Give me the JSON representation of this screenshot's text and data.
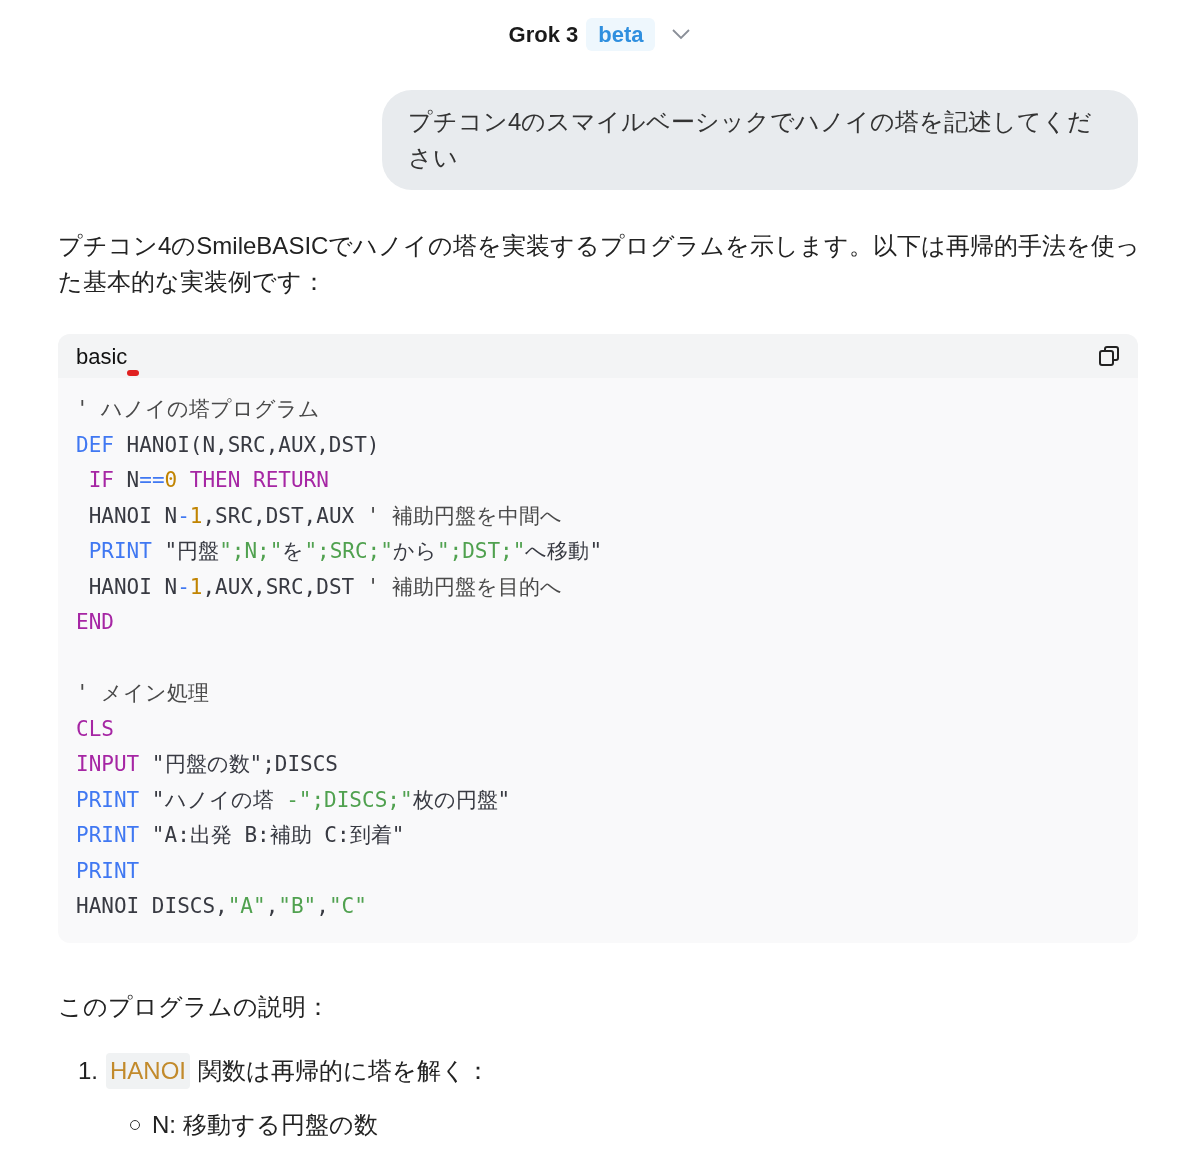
{
  "header": {
    "title": "Grok 3",
    "badge": "beta"
  },
  "user_message": "プチコン4のスマイルベーシックでハノイの塔を記述してください",
  "response_intro": "プチコン4のSmileBASICでハノイの塔を実装するプログラムを示します。以下は再帰的手法を使った基本的な実装例です：",
  "code_block": {
    "language": "basic",
    "lines": [
      {
        "kind": "code",
        "tokens": [
          {
            "kind": "comment",
            "s": "' ハノイの塔プログラム"
          }
        ]
      },
      {
        "kind": "code",
        "tokens": [
          {
            "kind": "blue",
            "s": "DEF"
          },
          {
            "kind": "plain",
            "s": " HANOI(N,SRC,AUX,DST)"
          }
        ]
      },
      {
        "kind": "code",
        "tokens": [
          {
            "kind": "purple",
            "s": " IF"
          },
          {
            "kind": "plain",
            "s": " N"
          },
          {
            "kind": "blue",
            "s": "=="
          },
          {
            "kind": "number",
            "s": "0"
          },
          {
            "kind": "purple",
            "s": " THEN RETURN"
          }
        ]
      },
      {
        "kind": "code",
        "tokens": [
          {
            "kind": "plain",
            "s": " HANOI N"
          },
          {
            "kind": "blue",
            "s": "-"
          },
          {
            "kind": "number",
            "s": "1"
          },
          {
            "kind": "plain",
            "s": ",SRC,DST,AUX"
          },
          {
            "kind": "comment",
            "s": " ' 補助円盤を中間へ"
          }
        ]
      },
      {
        "kind": "code",
        "tokens": [
          {
            "kind": "blue",
            "s": " PRINT"
          },
          {
            "kind": "plain",
            "s": " \"円盤"
          },
          {
            "kind": "string",
            "s": "\";N;\""
          },
          {
            "kind": "plain",
            "s": "を"
          },
          {
            "kind": "string",
            "s": "\";SRC;\""
          },
          {
            "kind": "plain",
            "s": "から"
          },
          {
            "kind": "string",
            "s": "\";DST;\""
          },
          {
            "kind": "plain",
            "s": "へ移動\""
          }
        ]
      },
      {
        "kind": "code",
        "tokens": [
          {
            "kind": "plain",
            "s": " HANOI N"
          },
          {
            "kind": "blue",
            "s": "-"
          },
          {
            "kind": "number",
            "s": "1"
          },
          {
            "kind": "plain",
            "s": ",AUX,SRC,DST"
          },
          {
            "kind": "comment",
            "s": " ' 補助円盤を目的へ"
          }
        ]
      },
      {
        "kind": "code",
        "tokens": [
          {
            "kind": "purple",
            "s": "END"
          }
        ]
      },
      {
        "kind": "blank"
      },
      {
        "kind": "code",
        "tokens": [
          {
            "kind": "comment",
            "s": "' メイン処理"
          }
        ]
      },
      {
        "kind": "code",
        "tokens": [
          {
            "kind": "purple",
            "s": "CLS"
          }
        ]
      },
      {
        "kind": "code",
        "tokens": [
          {
            "kind": "purple",
            "s": "INPUT"
          },
          {
            "kind": "plain",
            "s": " \"円盤の数\";DISCS"
          }
        ]
      },
      {
        "kind": "code",
        "tokens": [
          {
            "kind": "blue",
            "s": "PRINT"
          },
          {
            "kind": "plain",
            "s": " \"ハノイの塔 "
          },
          {
            "kind": "string",
            "s": "-\";DISCS;\""
          },
          {
            "kind": "plain",
            "s": "枚の円盤\""
          }
        ]
      },
      {
        "kind": "code",
        "tokens": [
          {
            "kind": "blue",
            "s": "PRINT"
          },
          {
            "kind": "plain",
            "s": " \"A:出発 B:補助 C:到着\""
          }
        ]
      },
      {
        "kind": "code",
        "tokens": [
          {
            "kind": "blue",
            "s": "PRINT"
          }
        ]
      },
      {
        "kind": "code",
        "tokens": [
          {
            "kind": "plain",
            "s": "HANOI DISCS,"
          },
          {
            "kind": "string",
            "s": "\"A\""
          },
          {
            "kind": "plain",
            "s": ","
          },
          {
            "kind": "string",
            "s": "\"B\""
          },
          {
            "kind": "plain",
            "s": ","
          },
          {
            "kind": "string",
            "s": "\"C\""
          }
        ]
      }
    ]
  },
  "explanation_heading": "このプログラムの説明：",
  "explanation_list": [
    {
      "marker": "1.",
      "code": "HANOI",
      "text": "関数は再帰的に塔を解く：",
      "children": [
        {
          "text": "N: 移動する円盤の数"
        }
      ]
    }
  ]
}
